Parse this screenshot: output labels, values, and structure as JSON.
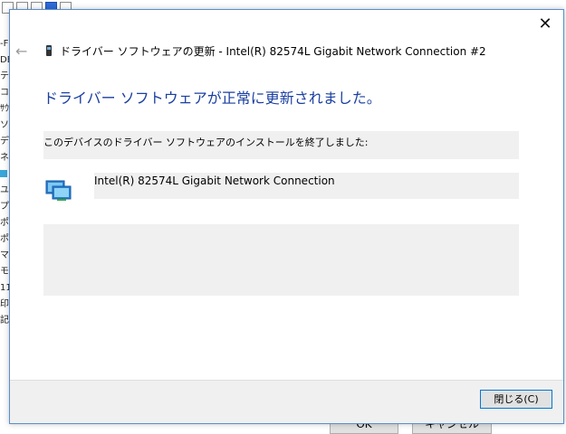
{
  "dialog": {
    "title": "ドライバー ソフトウェアの更新 - Intel(R) 82574L Gigabit Network Connection #2",
    "headline": "ドライバー ソフトウェアが正常に更新されました。",
    "status_text": "このデバイスのドライバー ソフトウェアのインストールを終了しました:",
    "device_name": "Intel(R) 82574L Gigabit Network Connection",
    "close_symbol": "✕",
    "back_symbol": "←",
    "close_button_label": "閉じる(C)",
    "accent_color": "#1a3fa0"
  },
  "background": {
    "side_text": [
      "-F",
      "DE",
      "テ",
      "コン",
      "ｻｳ",
      "ソフ",
      "ディ",
      "ネ",
      "",
      "ユ",
      "プロ",
      "ポー",
      "ポー",
      "マウ",
      "モニ",
      "11",
      "印",
      "記"
    ],
    "ok_label": "OK",
    "cancel_label": "キャンセル"
  }
}
